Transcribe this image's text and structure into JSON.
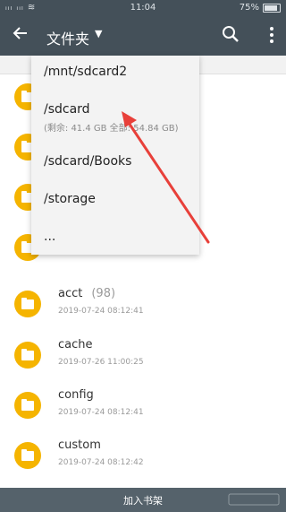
{
  "status_bar": {
    "signal": "ᵢᵢₗ ᵢᵢₗ ≋",
    "time": "11:04",
    "battery_percent": "75%"
  },
  "app_bar": {
    "title": "文件夹",
    "caret": "▼",
    "back_icon": "arrow-left-icon",
    "search_icon": "search-icon",
    "more_icon": "more-vert-icon"
  },
  "dropdown": {
    "items": [
      {
        "path": "/mnt/sdcard2"
      },
      {
        "path": "/sdcard",
        "detail": "(剩余: 41.4 GB 全部: 54.84 GB)"
      },
      {
        "path": "/sdcard/Books"
      },
      {
        "path": "/storage"
      },
      {
        "path": "..."
      }
    ]
  },
  "folders": [
    {
      "name": "acct",
      "count": "(98)",
      "date": "2019-07-24 08:12:41"
    },
    {
      "name": "cache",
      "date": "2019-07-26 11:00:25"
    },
    {
      "name": "config",
      "date": "2019-07-24 08:12:41"
    },
    {
      "name": "custom",
      "date": "2019-07-24 08:12:42"
    }
  ],
  "bottom_bar": {
    "label": "加入书架"
  },
  "colors": {
    "appbar": "#445059",
    "folder": "#f5b400",
    "arrow": "#e8403a"
  }
}
